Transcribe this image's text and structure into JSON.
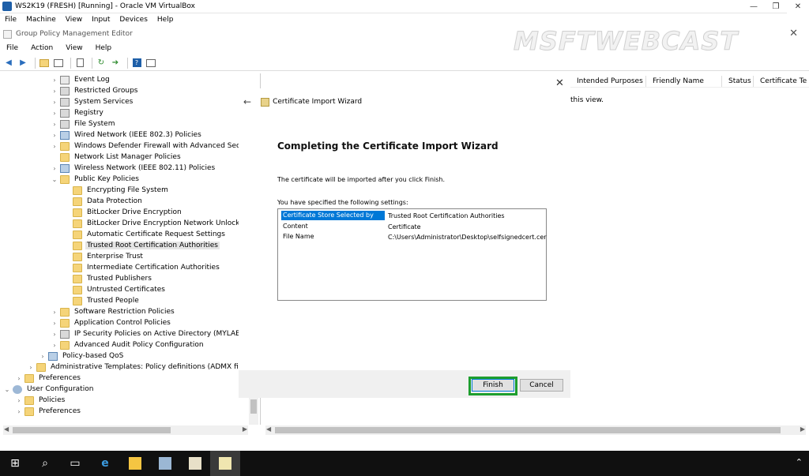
{
  "vbox": {
    "title": "WS2K19 (FRESH) [Running] - Oracle VM VirtualBox",
    "menu": [
      "File",
      "Machine",
      "View",
      "Input",
      "Devices",
      "Help"
    ]
  },
  "gpme": {
    "title": "Group Policy Management Editor",
    "menu": [
      "File",
      "Action",
      "View",
      "Help"
    ]
  },
  "watermark": "MSFTWEBCAST",
  "tree": [
    {
      "label": "Event Log",
      "icon": "doc"
    },
    {
      "label": "Restricted Groups",
      "icon": "lock"
    },
    {
      "label": "System Services",
      "icon": "lock"
    },
    {
      "label": "Registry",
      "icon": "lock"
    },
    {
      "label": "File System",
      "icon": "lock"
    },
    {
      "label": "Wired Network (IEEE 802.3) Policies",
      "icon": "net"
    },
    {
      "label": "Windows Defender Firewall with Advanced Securit",
      "icon": "folder"
    },
    {
      "label": "Network List Manager Policies",
      "icon": "folder"
    },
    {
      "label": "Wireless Network (IEEE 802.11) Policies",
      "icon": "net"
    },
    {
      "label": "Public Key Policies",
      "icon": "folder"
    },
    {
      "label": "Encrypting File System",
      "icon": "folder"
    },
    {
      "label": "Data Protection",
      "icon": "folder"
    },
    {
      "label": "BitLocker Drive Encryption",
      "icon": "folder"
    },
    {
      "label": "BitLocker Drive Encryption Network Unlock Ce",
      "icon": "folder"
    },
    {
      "label": "Automatic Certificate Request Settings",
      "icon": "folder"
    },
    {
      "label": "Trusted Root Certification Authorities",
      "icon": "folder"
    },
    {
      "label": "Enterprise Trust",
      "icon": "folder"
    },
    {
      "label": "Intermediate Certification Authorities",
      "icon": "folder"
    },
    {
      "label": "Trusted Publishers",
      "icon": "folder"
    },
    {
      "label": "Untrusted Certificates",
      "icon": "folder"
    },
    {
      "label": "Trusted People",
      "icon": "folder"
    },
    {
      "label": "Software Restriction Policies",
      "icon": "folder"
    },
    {
      "label": "Application Control Policies",
      "icon": "folder"
    },
    {
      "label": "IP Security Policies on Active Directory (MYLAB.LC",
      "icon": "lock"
    },
    {
      "label": "Advanced Audit Policy Configuration",
      "icon": "folder"
    },
    {
      "label": "Policy-based QoS",
      "icon": "net"
    },
    {
      "label": "Administrative Templates: Policy definitions (ADMX files)",
      "icon": "folder"
    },
    {
      "label": "Preferences",
      "icon": "folder"
    },
    {
      "label": "User Configuration",
      "icon": "user"
    },
    {
      "label": "Policies",
      "icon": "folder"
    },
    {
      "label": "Preferences",
      "icon": "folder"
    }
  ],
  "columns": [
    "Intended Purposes",
    "Friendly Name",
    "Status",
    "Certificate Te"
  ],
  "right_note": "this view.",
  "wizard": {
    "header": "Certificate Import Wizard",
    "title": "Completing the Certificate Import Wizard",
    "message": "The certificate will be imported after you click Finish.",
    "settings_label": "You have specified the following settings:",
    "settings": [
      {
        "key": "Certificate Store Selected by User",
        "value": "Trusted Root Certification Authorities"
      },
      {
        "key": "Content",
        "value": "Certificate"
      },
      {
        "key": "File Name",
        "value": "C:\\Users\\Administrator\\Desktop\\selfsignedcert.cer"
      }
    ],
    "finish_label": "Finish",
    "cancel_label": "Cancel"
  }
}
